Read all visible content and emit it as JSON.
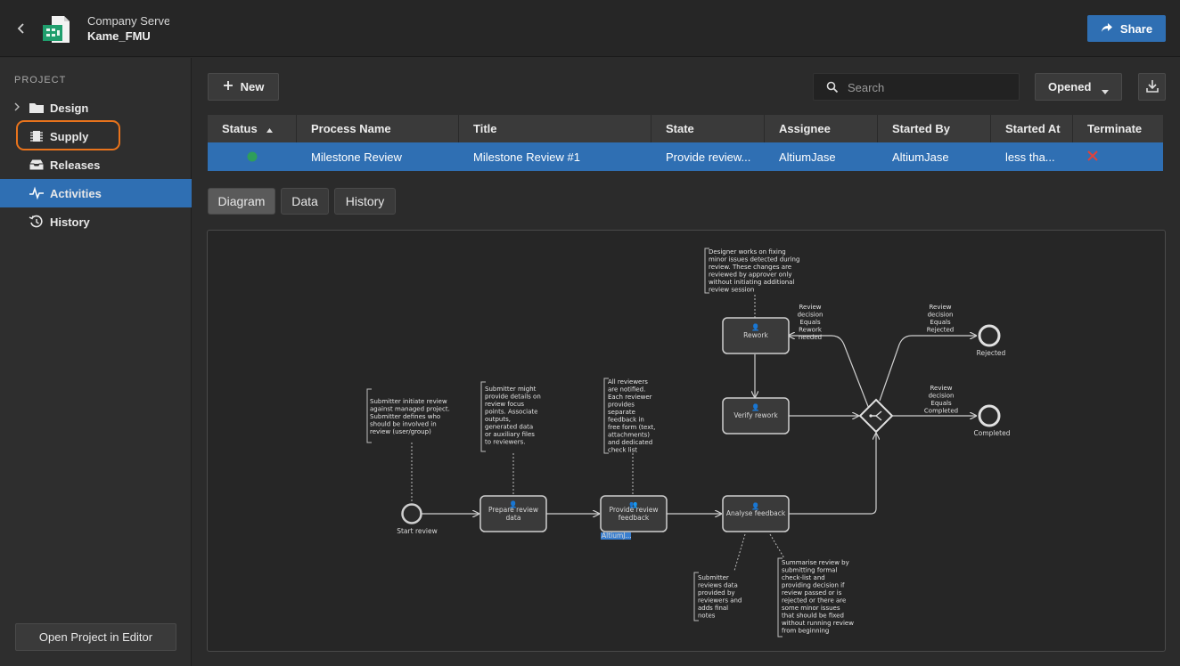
{
  "header": {
    "server_name": "Company Server",
    "project_name": "Kame_FMU",
    "share_label": "Share"
  },
  "sidebar": {
    "heading": "PROJECT",
    "items": [
      {
        "label": "Design",
        "icon": "folder-icon"
      },
      {
        "label": "Supply",
        "icon": "chip-icon"
      },
      {
        "label": "Releases",
        "icon": "inbox-icon"
      },
      {
        "label": "Activities",
        "icon": "activity-pulse-icon"
      },
      {
        "label": "History",
        "icon": "history-clock-icon"
      }
    ],
    "active_item": "Activities",
    "open_editor_label": "Open Project in Editor"
  },
  "toolbar": {
    "new_label": "New",
    "search_placeholder": "Search",
    "filter_value": "Opened"
  },
  "grid": {
    "columns": [
      "Status",
      "Process Name",
      "Title",
      "State",
      "Assignee",
      "Started By",
      "Started At",
      "Terminate"
    ],
    "rows": [
      {
        "status": "active",
        "process_name": "Milestone Review",
        "title": "Milestone Review #1",
        "state": "Provide review...",
        "assignee": "AltiumJase",
        "started_by": "AltiumJase",
        "started_at": "less tha..."
      }
    ]
  },
  "tabs": [
    "Diagram",
    "Data",
    "History"
  ],
  "active_tab": "Diagram",
  "diagram": {
    "nodes": {
      "start": "Start review",
      "prepare_1": "Prepare review",
      "prepare_2": "data",
      "provide_1": "Provide review",
      "provide_2": "feedback",
      "analyse": "Analyse feedback",
      "rework": "Rework",
      "verify": "Verify rework",
      "rejected": "Rejected",
      "completed": "Completed",
      "assignee_tag": "AltiumJ..."
    },
    "edge_labels": {
      "rework": [
        "Review",
        "decision",
        "Equals",
        "Rework",
        "needed"
      ],
      "rejected": [
        "Review",
        "decision",
        "Equals",
        "Rejected"
      ],
      "completed": [
        "Review",
        "decision",
        "Equals",
        "Completed"
      ]
    },
    "notes": {
      "start": [
        "Submitter initiate review",
        "against managed project.",
        "Submitter defines who",
        "should be involved in",
        "review (user/group)"
      ],
      "prepare": [
        "Submitter might",
        "provide details on",
        "review focus",
        "points. Associate",
        "outputs,",
        "generated data",
        "or auxiliary files",
        "to reviewers."
      ],
      "provide": [
        "All reviewers",
        "are notified.",
        "Each reviewer",
        "provides",
        "separate",
        "feedback in",
        "free form (text,",
        "attachments)",
        "and dedicated",
        "check list"
      ],
      "rework": [
        "Designer works on fixing",
        "minor issues detected during",
        "review. These changes are",
        "reviewed by approver only",
        "without initiating additional",
        "review session"
      ],
      "analyse_left": [
        "Submitter",
        "reviews data",
        "provided by",
        "reviewers and",
        "adds final",
        "notes"
      ],
      "analyse_right": [
        "Summarise review by",
        "submitting formal",
        "check-list and",
        "providing decision if",
        "review passed or is",
        "rejected or there are",
        "some minor issues",
        "that should be fixed",
        "without running review",
        "from beginning"
      ]
    }
  },
  "colors": {
    "accent": "#2f6fb3",
    "focus_ring": "#e8731c",
    "status_active": "#2e9e5b",
    "terminate": "#e0423a"
  }
}
